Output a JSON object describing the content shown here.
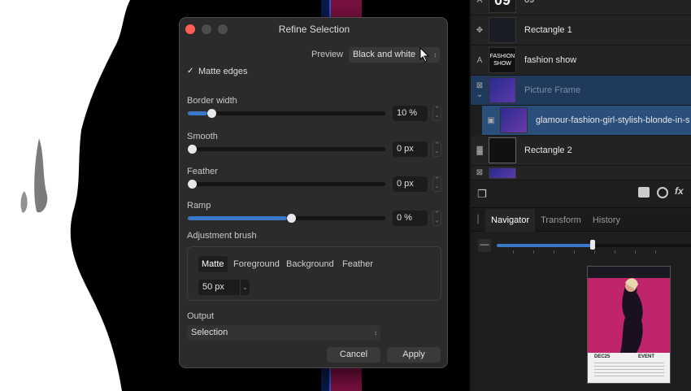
{
  "dialog": {
    "title": "Refine Selection",
    "preview_label": "Preview",
    "preview_value": "Black and white",
    "matte_edges_label": "Matte edges",
    "matte_edges_checked": true,
    "sliders": [
      {
        "label": "Border width",
        "value": "10 %",
        "fraction": 0.1
      },
      {
        "label": "Smooth",
        "value": "0 px",
        "fraction": 0.0
      },
      {
        "label": "Feather",
        "value": "0 px",
        "fraction": 0.0
      },
      {
        "label": "Ramp",
        "value": "0 %",
        "fraction": 0.5
      }
    ],
    "brush_label": "Adjustment brush",
    "brush_modes": [
      "Matte",
      "Foreground",
      "Background",
      "Feather"
    ],
    "brush_active": "Matte",
    "brush_size": "50 px",
    "output_label": "Output",
    "output_value": "Selection",
    "cancel_label": "Cancel",
    "apply_label": "Apply"
  },
  "layers": {
    "items": [
      {
        "name": "09",
        "icon": "text-icon"
      },
      {
        "name": "Rectangle 1",
        "icon": "shape-icon"
      },
      {
        "name": "fashion show",
        "icon": "text-icon",
        "thumb_text": "FASHION SHOW"
      },
      {
        "name": "Picture Frame",
        "icon": "frame-icon"
      },
      {
        "name": "glamour-fashion-girl-stylish-blonde-in-s",
        "icon": "image-icon"
      },
      {
        "name": "Rectangle 2",
        "icon": "checker-icon"
      }
    ]
  },
  "tabs": {
    "items": [
      "Navigator",
      "Transform",
      "History"
    ],
    "active": "Navigator"
  },
  "navigator": {
    "zoom_fraction": 0.49,
    "thumb_date": "DEC25",
    "thumb_event": "EVENT"
  },
  "colors": {
    "accent": "#3c78c9",
    "close": "#ff5f57",
    "poster_pink": "#c0246a",
    "layer_selected": "#1f3a5a"
  }
}
